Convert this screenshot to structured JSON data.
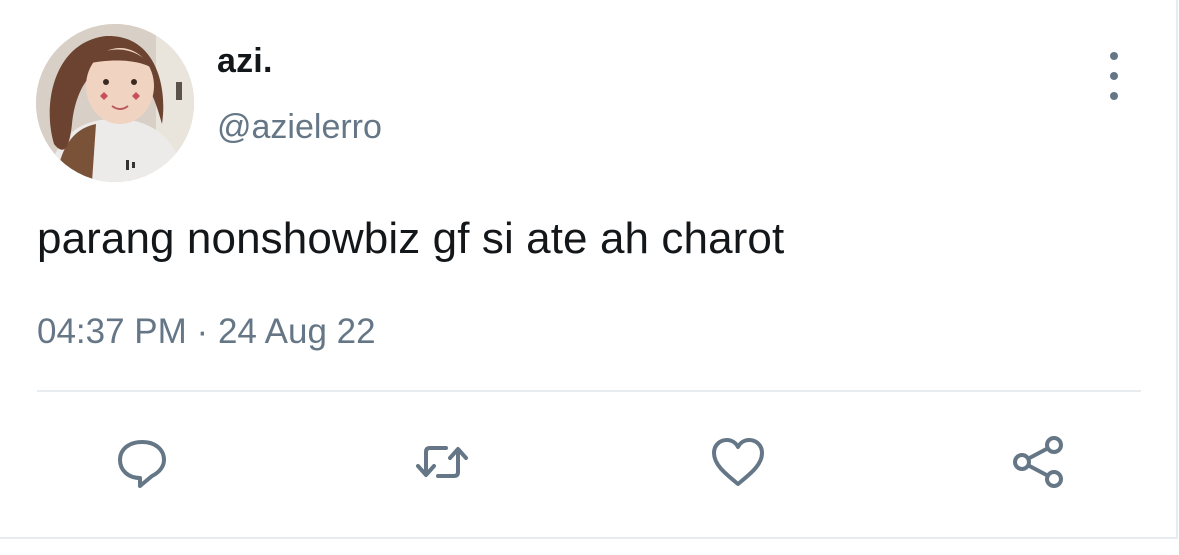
{
  "tweet": {
    "author": {
      "display_name": "azi.",
      "handle": "@azielerro",
      "avatar_icon": "profile-photo"
    },
    "text": "parang nonshowbiz gf si ate ah charot",
    "time": "04:37 PM",
    "separator": "·",
    "date": "24 Aug 22"
  },
  "actions": [
    {
      "name": "reply",
      "icon": "speech-bubble-icon"
    },
    {
      "name": "retweet",
      "icon": "retweet-arrows-icon"
    },
    {
      "name": "like",
      "icon": "heart-icon"
    },
    {
      "name": "share",
      "icon": "share-nodes-icon"
    }
  ],
  "more_icon": "vertical-ellipsis-icon",
  "colors": {
    "text_primary": "#14171a",
    "text_secondary": "#657786",
    "divider": "#e6ecf0"
  }
}
